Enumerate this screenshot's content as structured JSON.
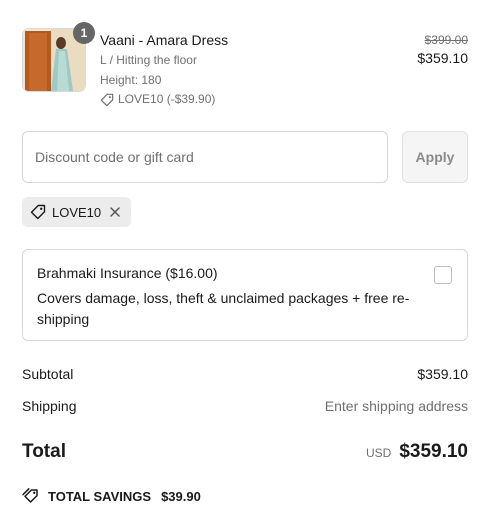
{
  "product": {
    "quantity": "1",
    "name": "Vaani - Amara Dress",
    "variant": "L / Hitting the floor",
    "height": "Height: 180",
    "discount_tag": "LOVE10 (-$39.90)",
    "original_price": "$399.00",
    "final_price": "$359.10"
  },
  "discount": {
    "placeholder": "Discount code or gift card",
    "value": "",
    "apply_label": "Apply",
    "applied_code": "LOVE10"
  },
  "insurance": {
    "title": "Brahmaki Insurance ($16.00)",
    "description": "Covers damage, loss, theft & unclaimed packages + free re-shipping",
    "checked": false
  },
  "summary": {
    "subtotal_label": "Subtotal",
    "subtotal_value": "$359.10",
    "shipping_label": "Shipping",
    "shipping_value": "Enter shipping address",
    "total_label": "Total",
    "currency": "USD",
    "total_value": "$359.10",
    "savings_label": "TOTAL SAVINGS",
    "savings_value": "$39.90"
  },
  "icons": {
    "product_tag": "tag-icon",
    "chip_tag": "tag-icon",
    "chip_remove": "close-icon",
    "savings": "tags-icon"
  }
}
